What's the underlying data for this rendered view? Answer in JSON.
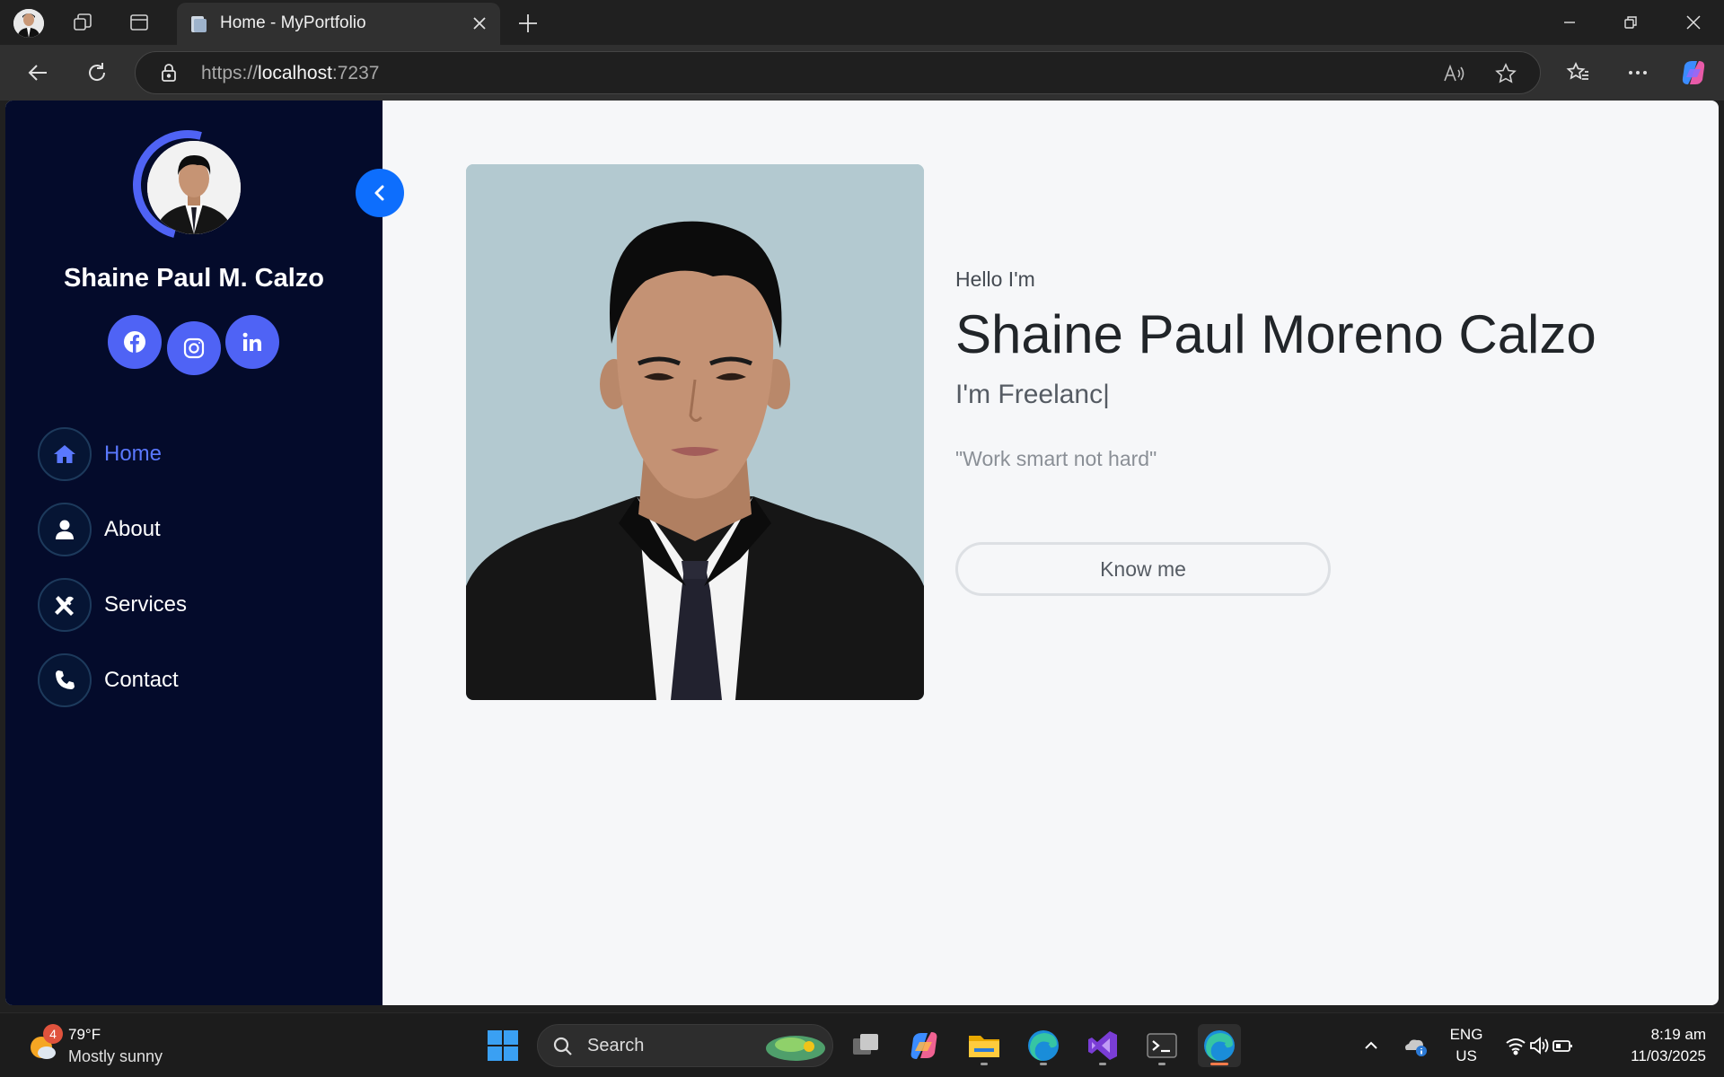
{
  "browser": {
    "tab_title": "Home - MyPortfolio",
    "url_scheme": "https://",
    "url_host": "localhost",
    "url_port": ":7237"
  },
  "sidebar": {
    "name": "Shaine Paul M. Calzo",
    "social": [
      {
        "icon": "facebook-icon"
      },
      {
        "icon": "instagram-icon"
      },
      {
        "icon": "linkedin-icon"
      }
    ],
    "nav": [
      {
        "label": "Home",
        "icon": "home-icon",
        "active": true
      },
      {
        "label": "About",
        "icon": "user-icon",
        "active": false
      },
      {
        "label": "Services",
        "icon": "tools-icon",
        "active": false
      },
      {
        "label": "Contact",
        "icon": "phone-icon",
        "active": false
      }
    ]
  },
  "hero": {
    "greeting": "Hello I'm",
    "full_name": "Shaine Paul Moreno Calzo",
    "role": "I'm Freelanc|",
    "quote": "\"Work smart not hard\"",
    "cta": "Know me"
  },
  "taskbar": {
    "weather_badge": "4",
    "weather_temp": "79°F",
    "weather_desc": "Mostly sunny",
    "search_label": "Search",
    "lang_line1": "ENG",
    "lang_line2": "US",
    "time": "8:19 am",
    "date": "11/03/2025"
  },
  "colors": {
    "sidebar_bg": "#040b2b",
    "accent": "#4f63f5",
    "toggle": "#0d6efd",
    "active_nav": "#5a78ff",
    "page_bg": "#f6f7f9"
  }
}
